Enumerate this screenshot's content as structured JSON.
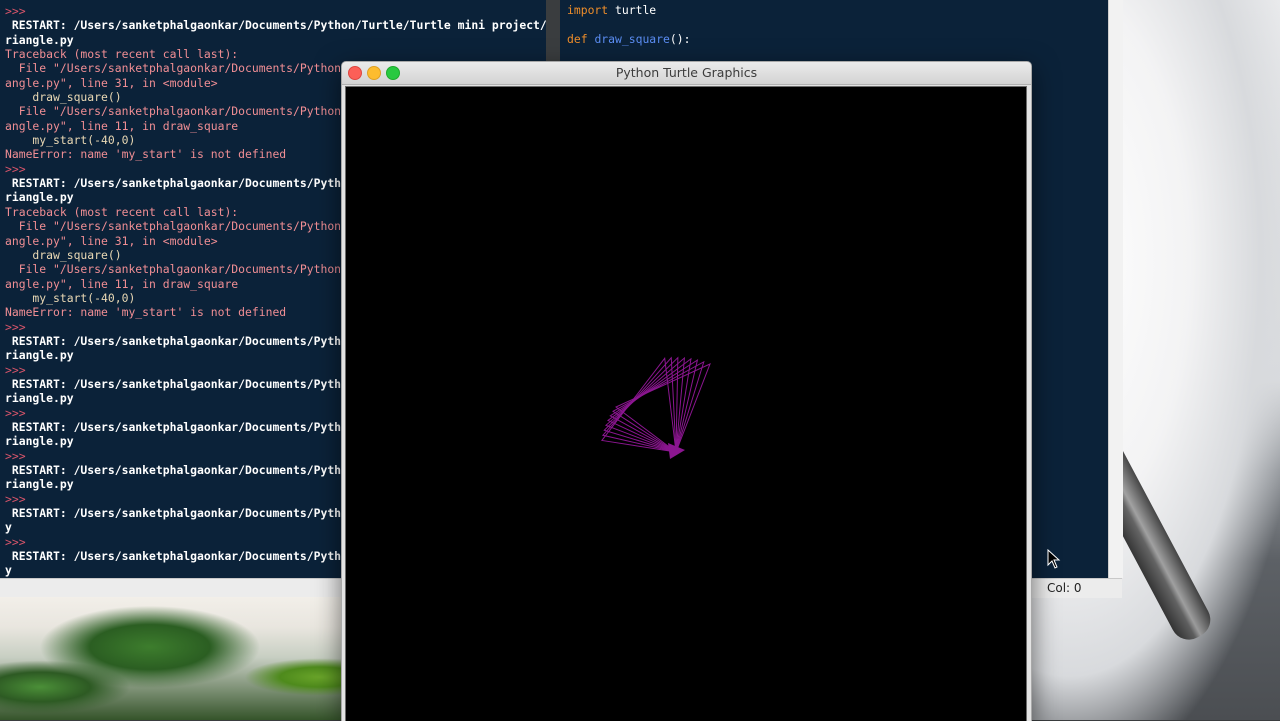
{
  "shell": {
    "lines": [
      {
        "text": ">>>",
        "kind": "prompt"
      },
      {
        "text": " RESTART: /Users/sanketphalgaonkar/Documents/Python/Turtle/Turtle mini project/T",
        "kind": "restart"
      },
      {
        "text": "riangle.py",
        "kind": "restart"
      },
      {
        "text": "Traceback (most recent call last):",
        "kind": "err"
      },
      {
        "text": "  File \"/Users/sanketphalgaonkar/Documents/Python/",
        "kind": "err"
      },
      {
        "text": "angle.py\", line 31, in <module>",
        "kind": "err"
      },
      {
        "text": "    draw_square()",
        "kind": "code"
      },
      {
        "text": "  File \"/Users/sanketphalgaonkar/Documents/Python/",
        "kind": "err"
      },
      {
        "text": "angle.py\", line 11, in draw_square",
        "kind": "err"
      },
      {
        "text": "    my_start(-40,0)",
        "kind": "code"
      },
      {
        "text": "NameError: name 'my_start' is not defined",
        "kind": "err"
      },
      {
        "text": ">>>",
        "kind": "prompt"
      },
      {
        "text": " RESTART: /Users/sanketphalgaonkar/Documents/Pytho",
        "kind": "restart"
      },
      {
        "text": "riangle.py",
        "kind": "restart"
      },
      {
        "text": "Traceback (most recent call last):",
        "kind": "err"
      },
      {
        "text": "  File \"/Users/sanketphalgaonkar/Documents/Python/",
        "kind": "err"
      },
      {
        "text": "angle.py\", line 31, in <module>",
        "kind": "err"
      },
      {
        "text": "    draw_square()",
        "kind": "code"
      },
      {
        "text": "  File \"/Users/sanketphalgaonkar/Documents/Python/",
        "kind": "err"
      },
      {
        "text": "angle.py\", line 11, in draw_square",
        "kind": "err"
      },
      {
        "text": "    my_start(-40,0)",
        "kind": "code"
      },
      {
        "text": "NameError: name 'my_start' is not defined",
        "kind": "err"
      },
      {
        "text": ">>>",
        "kind": "prompt"
      },
      {
        "text": " RESTART: /Users/sanketphalgaonkar/Documents/Pytho",
        "kind": "restart"
      },
      {
        "text": "riangle.py",
        "kind": "restart"
      },
      {
        "text": ">>>",
        "kind": "prompt"
      },
      {
        "text": " RESTART: /Users/sanketphalgaonkar/Documents/Pytho",
        "kind": "restart"
      },
      {
        "text": "riangle.py",
        "kind": "restart"
      },
      {
        "text": ">>>",
        "kind": "prompt"
      },
      {
        "text": " RESTART: /Users/sanketphalgaonkar/Documents/Pytho",
        "kind": "restart"
      },
      {
        "text": "riangle.py",
        "kind": "restart"
      },
      {
        "text": ">>>",
        "kind": "prompt"
      },
      {
        "text": " RESTART: /Users/sanketphalgaonkar/Documents/Pytho",
        "kind": "restart"
      },
      {
        "text": "riangle.py",
        "kind": "restart"
      },
      {
        "text": ">>>",
        "kind": "prompt"
      },
      {
        "text": " RESTART: /Users/sanketphalgaonkar/Documents/Pytho",
        "kind": "restart"
      },
      {
        "text": "y",
        "kind": "restart"
      },
      {
        "text": ">>>",
        "kind": "prompt"
      },
      {
        "text": " RESTART: /Users/sanketphalgaonkar/Documents/Pytho",
        "kind": "restart"
      },
      {
        "text": "y",
        "kind": "restart"
      }
    ]
  },
  "editor": {
    "import_kw": "import",
    "import_name": " turtle",
    "def_kw": "def",
    "func_name": "draw_square",
    "func_tail": "():",
    "status_left": ")",
    "status_col": "Col: 0"
  },
  "turtle_window": {
    "title": "Python Turtle Graphics",
    "pen_color": "#8b1690",
    "drawing_shape": "rotated-triangles",
    "triangle_count": 8
  },
  "colors": {
    "shell_bg": "#0b2239",
    "prompt": "#d8556a",
    "error_text": "#f08e94",
    "keyword": "#ee8d2a",
    "function_name": "#5b8df2"
  }
}
